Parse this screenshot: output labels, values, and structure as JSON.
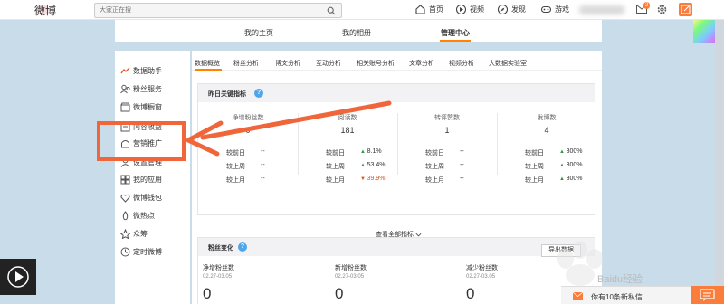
{
  "header": {
    "logo": "微博",
    "search_placeholder": "大家正在搜",
    "nav": [
      {
        "label": "首页",
        "icon": "home-icon"
      },
      {
        "label": "视频",
        "icon": "video-icon"
      },
      {
        "label": "发现",
        "icon": "discover-icon"
      },
      {
        "label": "游戏",
        "icon": "game-icon"
      }
    ],
    "mail_badge": "2"
  },
  "main_tabs": [
    "我的主页",
    "我的相册",
    "管理中心"
  ],
  "sidebar": {
    "items": [
      {
        "label": "数据助手",
        "icon": "trend-icon"
      },
      {
        "label": "粉丝服务",
        "icon": "fans-icon"
      },
      {
        "label": "微博橱窗",
        "icon": "shop-icon"
      },
      {
        "label": "内容收益",
        "icon": "income-icon"
      },
      {
        "label": "营销推广",
        "icon": "promote-icon"
      },
      {
        "label": "设置管理",
        "icon": "settings-icon"
      },
      {
        "label": "我的应用",
        "icon": "apps-icon"
      },
      {
        "label": "微博钱包",
        "icon": "wallet-icon"
      },
      {
        "label": "微热点",
        "icon": "hotspot-icon"
      },
      {
        "label": "众筹",
        "icon": "crowdfund-icon"
      },
      {
        "label": "定时微博",
        "icon": "clock-icon"
      }
    ]
  },
  "subtabs": [
    "数据概览",
    "粉丝分析",
    "博文分析",
    "互动分析",
    "相关账号分析",
    "文章分析",
    "视频分析",
    "大数据实验室"
  ],
  "yesterday": {
    "title": "昨日关键指标",
    "metrics": [
      {
        "label": "净增粉丝数",
        "value": "0"
      },
      {
        "label": "阅读数",
        "value": "181"
      },
      {
        "label": "转评赞数",
        "value": "1"
      },
      {
        "label": "发博数",
        "value": "4"
      }
    ],
    "compare_labels": [
      "较前日",
      "较上周",
      "较上月"
    ],
    "compare": [
      [
        {
          "v": "--",
          "dir": ""
        },
        {
          "v": "--",
          "dir": ""
        },
        {
          "v": "--",
          "dir": ""
        }
      ],
      [
        {
          "v": "8.1%",
          "dir": "up"
        },
        {
          "v": "53.4%",
          "dir": "up"
        },
        {
          "v": "39.9%",
          "dir": "down"
        }
      ],
      [
        {
          "v": "--",
          "dir": ""
        },
        {
          "v": "--",
          "dir": ""
        },
        {
          "v": "--",
          "dir": ""
        }
      ],
      [
        {
          "v": "300%",
          "dir": "up"
        },
        {
          "v": "300%",
          "dir": "up"
        },
        {
          "v": "300%",
          "dir": "up"
        }
      ]
    ],
    "view_all": "查看全部指标"
  },
  "fans": {
    "title": "粉丝变化",
    "export": "导出数据",
    "metrics": [
      {
        "label": "净增粉丝数",
        "date": "02.27-03.05",
        "value": "0"
      },
      {
        "label": "新增粉丝数",
        "date": "02.27-03.05",
        "value": "0"
      },
      {
        "label": "减少粉丝数",
        "date": "02.27-03.05",
        "value": "0"
      }
    ]
  },
  "message_bar": "你有10条新私信",
  "watermark": "Baidu经验 jingyan.baidu.com",
  "colors": {
    "accent": "#ff8200",
    "arrow": "#f0653a",
    "up": "#2f9a3d",
    "down": "#d9541e"
  }
}
